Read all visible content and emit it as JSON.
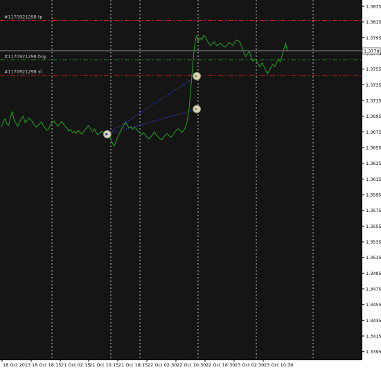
{
  "colors": {
    "background": "#151515",
    "price_line": "#1ea41e",
    "axis_text": "#c8c8c8",
    "grid": "#e6e6e6",
    "tp_sl": "#cc1f1f",
    "buy": "#2f9e2f",
    "current_price": "#b4b4b4",
    "trade_line": "#3344cc"
  },
  "chart_data": {
    "type": "line",
    "instrument_series": "price",
    "y_ticks": [
      "1.3835",
      "1.3815",
      "1.3795",
      "1.3775",
      "1.3755",
      "1.3735",
      "1.3715",
      "1.3695",
      "1.3675",
      "1.3655",
      "1.3635",
      "1.3615",
      "1.3595",
      "1.3575",
      "1.3555",
      "1.3535",
      "1.3515",
      "1.3495",
      "1.3475",
      "1.3455",
      "1.3435",
      "1.3415",
      "1.3395"
    ],
    "ylim": [
      1.3385,
      1.3843
    ],
    "x_ticks": [
      "18 Oct 2013",
      "18 Oct 18:15",
      "21 Oct 02:15",
      "21 Oct 10:15",
      "21 Oct 18:15",
      "22 Oct 02:30",
      "22 Oct 10:30",
      "22 Oct 18:30",
      "23 Oct 02:30",
      "23 Oct 10:30"
    ],
    "series": [
      {
        "values": [
          1.3681,
          1.3688,
          1.3692,
          1.3685,
          1.3683,
          1.3694,
          1.3701,
          1.369,
          1.3686,
          1.3682,
          1.3688,
          1.3692,
          1.3695,
          1.3687,
          1.3689,
          1.3693,
          1.3691,
          1.3688,
          1.3684,
          1.3681,
          1.3683,
          1.3685,
          1.3688,
          1.3683,
          1.368,
          1.3677,
          1.3679,
          1.3684,
          1.3687,
          1.3689,
          1.3685,
          1.3682,
          1.3686,
          1.3688,
          1.3685,
          1.3682,
          1.368,
          1.3676,
          1.3678,
          1.3674,
          1.3676,
          1.3673,
          1.3677,
          1.3675,
          1.3672,
          1.3675,
          1.3678,
          1.3681,
          1.3683,
          1.3678,
          1.3675,
          1.3679,
          1.3674,
          1.3671,
          1.3674,
          1.3676,
          1.3673,
          1.367,
          1.3672,
          1.367,
          1.3667,
          1.366,
          1.3657,
          1.3664,
          1.3669,
          1.3674,
          1.3679,
          1.3683,
          1.3687,
          1.3684,
          1.368,
          1.3682,
          1.3678,
          1.3681,
          1.3679,
          1.3676,
          1.3674,
          1.3671,
          1.3674,
          1.3671,
          1.3668,
          1.3666,
          1.3669,
          1.3672,
          1.3675,
          1.3671,
          1.3669,
          1.3666,
          1.3665,
          1.3668,
          1.3671,
          1.3673,
          1.367,
          1.3668,
          1.3671,
          1.3674,
          1.3677,
          1.3679,
          1.3677,
          1.3674,
          1.3677,
          1.3681,
          1.3689,
          1.3704,
          1.3732,
          1.376,
          1.3785,
          1.3797,
          1.379,
          1.3795,
          1.3792,
          1.3798,
          1.3796,
          1.3791,
          1.3787,
          1.3785,
          1.3788,
          1.379,
          1.3785,
          1.3786,
          1.3788,
          1.3786,
          1.3784,
          1.3783,
          1.3786,
          1.3789,
          1.3787,
          1.3785,
          1.3789,
          1.3792,
          1.3791,
          1.3789,
          1.3783,
          1.3776,
          1.3771,
          1.3774,
          1.3778,
          1.3771,
          1.3765,
          1.3768,
          1.3766,
          1.3761,
          1.3758,
          1.3763,
          1.3759,
          1.3754,
          1.3749,
          1.3753,
          1.3758,
          1.3761,
          1.3758,
          1.3763,
          1.3768,
          1.3764,
          1.3772,
          1.378,
          1.3788,
          1.3777
        ]
      }
    ],
    "levels": [
      {
        "name": "tp",
        "label": "#1170921298 tp",
        "price": 1.3817,
        "style": "dash-dot"
      },
      {
        "name": "buy",
        "label": "#1170921298 buy",
        "price": 1.3767,
        "style": "dash-dot"
      },
      {
        "name": "sl",
        "label": "#1170921298 sl",
        "price": 1.3748,
        "style": "dash-dot"
      }
    ],
    "current_price": "1.3779",
    "trade_markers": [
      {
        "icon": "sell-arrow-icon",
        "price": 1.3672,
        "pos": 0.37
      },
      {
        "icon": "close-arrow-icon",
        "price": 1.3746,
        "pos": 0.683
      },
      {
        "icon": "close-arrow-icon",
        "price": 1.3704,
        "pos": 0.683
      }
    ],
    "grid": "vertical dashed"
  }
}
